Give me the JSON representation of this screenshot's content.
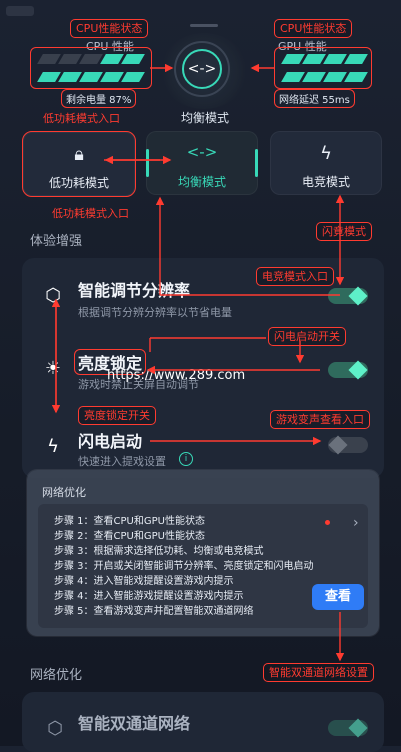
{
  "top": {
    "cpu_status_label": "CPU性能状态",
    "cpu_perf": "CPU 性能",
    "battery": "剩余电量 87%",
    "gpu_status_label": "CPU性能状态",
    "gpu_perf": "GPU 性能",
    "network_delay": "网络延迟 55ms",
    "low_power_entry": "低功耗模式入口",
    "balanced_title": "均衡模式"
  },
  "modes": {
    "low_power": "低功耗模式",
    "balanced": "均衡模式",
    "esports": "电竞模式",
    "low_power_entry2": "低功耗模式入口",
    "flash_mode": "闪竟模式"
  },
  "experience": {
    "section_title": "体验增强",
    "smart_res_title": "智能调节分辨率",
    "smart_res_desc": "根据调节分辨分辨率以节省电量",
    "esports_entry": "电竞模式入口",
    "flash_switch_label": "闪电启动开关",
    "brightness_title": "亮度锁定",
    "brightness_desc": "游戏时禁止关屏自动调节",
    "watermark": "https://www.289.com",
    "brightness_switch_label": "亮度锁定开关",
    "game_voice_entry": "游戏变声查看入口",
    "flash_title": "闪电启动",
    "flash_desc": "快速进入提戏设置"
  },
  "popup": {
    "title": "网络优化",
    "steps": [
      "步骤 1：查看CPU和GPU性能状态",
      "步骤 2：查看CPU和GPU性能状态",
      "步骤 3：根据需求选择低功耗、均衡或电竞模式",
      "步骤 3：开启或关闭智能调节分辨率、亮度锁定和闪电启动",
      "步骤 4：进入智能戏提醒设置游戏内提示",
      "步骤 4：进入智能游戏提醒设置游戏内提示",
      "步骤 5：查看游戏变声并配置智能双通道网络"
    ],
    "view_button": "查看",
    "dual_channel_label": "智能双通道网络设置"
  },
  "network": {
    "section_title": "网络优化",
    "dual_title": "智能双通道网络"
  },
  "colors": {
    "accent": "#38d9b8",
    "annotation": "#ff3b30",
    "button": "#2f7cf6"
  }
}
